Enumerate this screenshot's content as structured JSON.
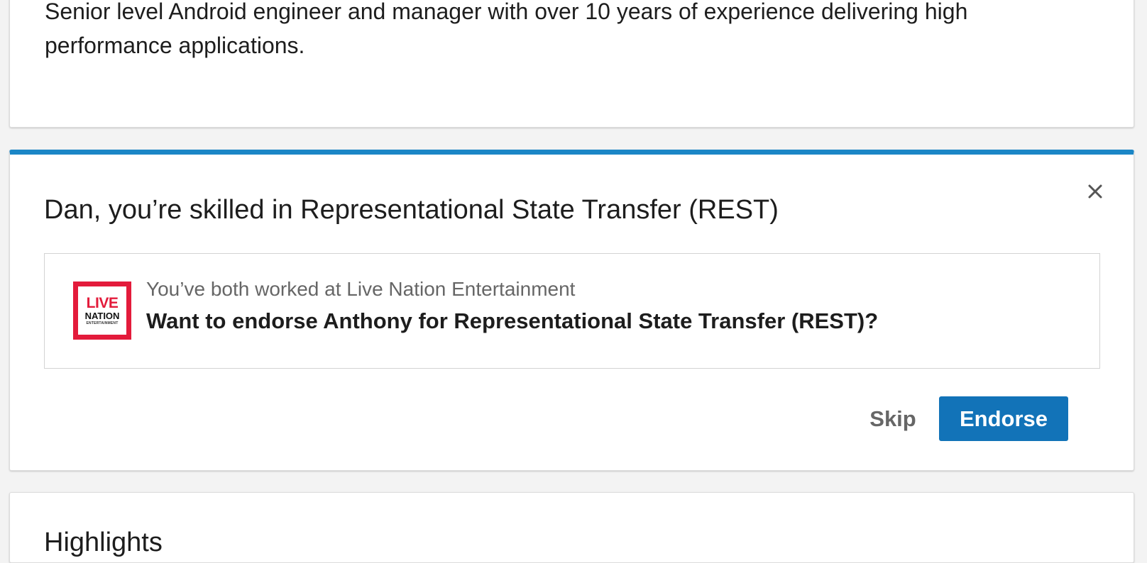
{
  "about": {
    "summary": "Senior level Android engineer and manager with over 10 years of experience delivering high performance applications."
  },
  "endorsement": {
    "title": "Dan, you’re skilled in Representational State Transfer (REST)",
    "close_icon": "close-icon",
    "accent_color": "#1b86c6",
    "context": {
      "company_logo": {
        "name": "live-nation-logo",
        "line1": "LIVE",
        "line2": "NATION",
        "line3": "ENTERTAINMENT",
        "color": "#e31b3b"
      },
      "shared_workplace": "You’ve both worked at Live Nation Entertainment",
      "question": "Want to endorse Anthony for Representational State Transfer (REST)?"
    },
    "actions": {
      "skip_label": "Skip",
      "endorse_label": "Endorse",
      "endorse_color": "#1273b8"
    }
  },
  "highlights": {
    "title": "Highlights"
  }
}
